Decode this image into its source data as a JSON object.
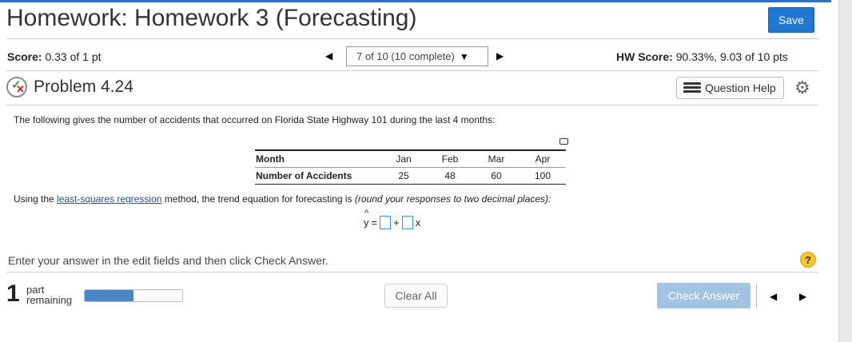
{
  "header": {
    "title": "Homework: Homework 3 (Forecasting)",
    "save_label": "Save"
  },
  "score": {
    "label": "Score:",
    "value": "0.33 of 1 pt"
  },
  "navigator": {
    "position_label": "7 of 10 (10 complete)",
    "prev_icon": "left-triangle",
    "next_icon": "right-triangle"
  },
  "hw_score": {
    "label": "HW Score:",
    "value": "90.33%, 9.03 of 10 pts"
  },
  "problem": {
    "title": "Problem 4.24",
    "status_icon": "partial-credit-icon",
    "question_help_label": "Question Help"
  },
  "question": {
    "stem": "The following gives the number of accidents that occurred on Florida State Highway 101 during the last 4 months:",
    "table": {
      "header_row_label": "Month",
      "data_row_label": "Number of Accidents",
      "months": [
        "Jan",
        "Feb",
        "Mar",
        "Apr"
      ],
      "accidents": [
        "25",
        "48",
        "60",
        "100"
      ]
    },
    "instruction_pre": "Using the ",
    "instruction_link": "least-squares regression",
    "instruction_mid": " method, the trend equation for forecasting is ",
    "instruction_italic": "(round your responses to two decimal places):",
    "equation": {
      "lhs": "y",
      "equals": "=",
      "plus": "+",
      "var": "x",
      "intercept_value": "",
      "slope_value": ""
    }
  },
  "footer": {
    "enter_text": "Enter your answer in the edit fields and then click Check Answer.",
    "help_symbol": "?",
    "parts_remaining_count": "1",
    "parts_remaining_line1": "part",
    "parts_remaining_line2": "remaining",
    "progress_fraction": 0.5,
    "clear_all_label": "Clear All",
    "check_answer_label": "Check Answer"
  },
  "colors": {
    "accent": "#1f77d0",
    "check_answer_disabled": "#a3c3e2",
    "progress_fill": "#4a86c5",
    "help_yellow": "#f4c431"
  }
}
